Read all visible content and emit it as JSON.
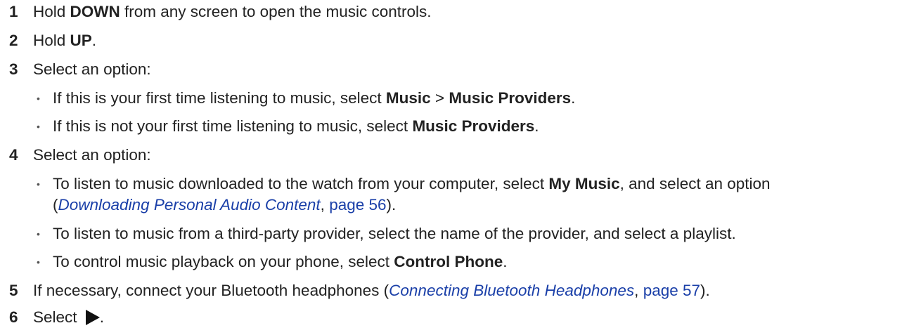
{
  "steps": [
    {
      "num": "1",
      "pre": "Hold ",
      "b1": "DOWN",
      "post": " from any screen to open the music controls."
    },
    {
      "num": "2",
      "pre": "Hold ",
      "b1": "UP",
      "post": "."
    },
    {
      "num": "3",
      "text": "Select an option:"
    },
    {
      "num": "4",
      "text": "Select an option:"
    },
    {
      "num": "5",
      "pre": "If necessary, connect your Bluetooth headphones (",
      "link": "Connecting Bluetooth Headphones",
      "mid": ", ",
      "page": "page 57",
      "post": ")."
    },
    {
      "num": "6",
      "pre": "Select ",
      "post": "."
    }
  ],
  "bullets_3": [
    {
      "pre": "If this is your first time listening to music, select ",
      "b1": "Music",
      "mid": " > ",
      "b2": "Music Providers",
      "post": "."
    },
    {
      "pre": "If this is not your first time listening to music, select ",
      "b1": "Music Providers",
      "post": "."
    }
  ],
  "bullets_4": [
    {
      "pre": "To listen to music downloaded to the watch from your computer, select ",
      "b1": "My Music",
      "post": ", and select an option",
      "cont_pre": "(",
      "link": "Downloading Personal Audio Content",
      "mid": ", ",
      "page": "page 56",
      "cont_post": ")."
    },
    {
      "pre": "To listen to music from a third-party provider, select the name of the provider, and select a playlist."
    },
    {
      "pre": "To control music playback on your phone, select ",
      "b1": "Control Phone",
      "post": "."
    }
  ],
  "bullet_glyph": "•",
  "icons": {
    "play": "play-icon"
  },
  "colors": {
    "text": "#222222",
    "link": "#1a3fa8"
  }
}
